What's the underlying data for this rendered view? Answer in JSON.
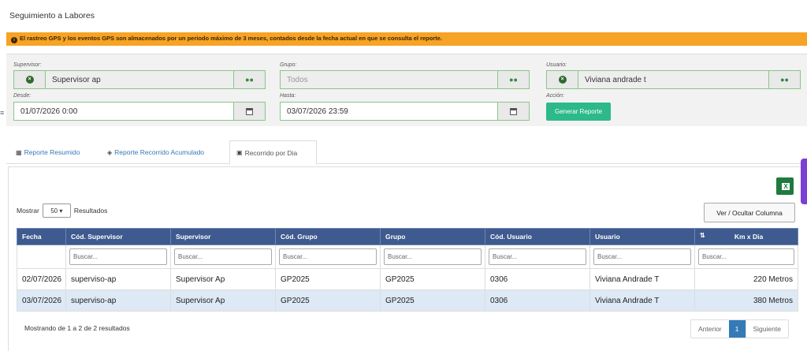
{
  "page": {
    "title": "Seguimiento a Labores"
  },
  "alert": {
    "icon": "info-circle-icon",
    "text": "El rastreo GPS y los eventos GPS son almacenados por un periodo máximo de 3 meses, contados desde la fecha actual en que se consulta el reporte."
  },
  "filters": {
    "supervisor": {
      "label": "Supervisor:",
      "value": "Supervisor ap"
    },
    "grupo": {
      "label": "Grupo:",
      "value": "Todos"
    },
    "usuario": {
      "label": "Usuario:",
      "value": "Viviana andrade t"
    },
    "desde": {
      "label": "Desde:",
      "value": "01/07/2026 0:00"
    },
    "hasta": {
      "label": "Hasta:",
      "value": "03/07/2026 23:59"
    },
    "accion": {
      "label": "Acción:",
      "button": "Generar Reporte"
    }
  },
  "tabs": [
    {
      "label": "Reporte Resumido",
      "icon": "table-icon"
    },
    {
      "label": "Reporte Recorrido Acumulado",
      "icon": "binoculars-icon"
    },
    {
      "label": "Recorrido por Dia",
      "icon": "calendar-icon",
      "active": true
    }
  ],
  "toolbar": {
    "show_prefix": "Mostrar",
    "page_size": "50",
    "show_suffix": "Resultados",
    "columns_button": "Ver / Ocultar Columna",
    "export_icon": "excel-icon"
  },
  "table": {
    "headers": [
      "Fecha",
      "Cód. Supervisor",
      "Supervisor",
      "Cód. Grupo",
      "Grupo",
      "Cód. Usuario",
      "Usuario",
      "Km x Dia"
    ],
    "search_placeholder": "Buscar...",
    "rows": [
      [
        "02/07/2026",
        "superviso-ap",
        "Supervisor Ap",
        "GP2025",
        "GP2025",
        "0306",
        "Viviana Andrade T",
        "220 Metros"
      ],
      [
        "03/07/2026",
        "superviso-ap",
        "Supervisor Ap",
        "GP2025",
        "GP2025",
        "0306",
        "Viviana Andrade T",
        "380 Metros"
      ]
    ]
  },
  "footer": {
    "info": "Mostrando de 1 a 2 de 2 resultados",
    "prev": "Anterior",
    "current": "1",
    "next": "Siguiente"
  },
  "colors": {
    "header": "#3e5a8e",
    "alert": "#f7a325",
    "accent_button": "#2db98a",
    "excel": "#1f7a3d"
  }
}
